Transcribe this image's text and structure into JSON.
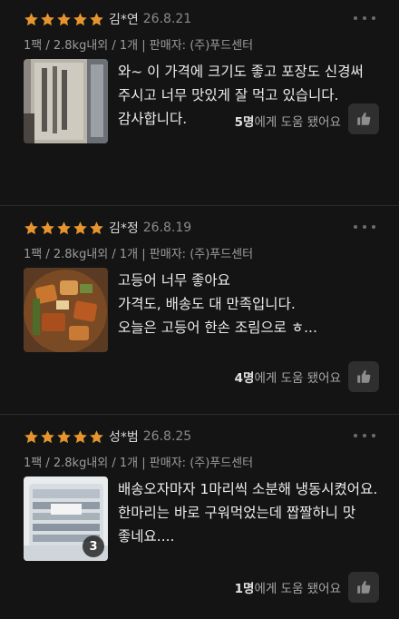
{
  "colors": {
    "background": "#141414",
    "star": "#e6952e",
    "text": "#ececec",
    "muted": "#9c9c9c"
  },
  "reviews": [
    {
      "rating": 5,
      "reviewer": "김*연",
      "date": "26.8.21",
      "option": "1팩 / 2.8kg내외 / 1개",
      "seller_label": "판매자: (주)푸드센터",
      "text": "와~ 이 가격에 크기도 좋고 포장도 신경써\n주시고 너무 맛있게 잘 먹고 있습니다.\n감사합니다.",
      "helpful_count": "5명",
      "helpful_suffix": "에게 도움 됐어요",
      "image_icon": "frozen-fish-package-photo"
    },
    {
      "rating": 5,
      "reviewer": "김*정",
      "date": "26.8.19",
      "option": "1팩 / 2.8kg내외 / 1개",
      "seller_label": "판매자: (주)푸드센터",
      "text": "고등어 너무 좋아요\n가격도, 배송도 대 만족입니다.\n오늘은 고등어 한손 조림으로 ㅎ...",
      "helpful_count": "4명",
      "helpful_suffix": "에게 도움 됐어요",
      "image_icon": "braised-mackerel-photo"
    },
    {
      "rating": 5,
      "reviewer": "성*범",
      "date": "26.8.25",
      "option": "1팩 / 2.8kg내외 / 1개",
      "seller_label": "판매자: (주)푸드센터",
      "text": "배송오자마자 1마리씩 소분해 냉동시켰어요.\n한마리는 바로 구워먹었는데 짭짤하니 맛\n좋네요....",
      "helpful_count": "1명",
      "helpful_suffix": "에게 도움 됐어요",
      "image_icon": "mackerel-package-photo",
      "image_count": "3"
    }
  ]
}
